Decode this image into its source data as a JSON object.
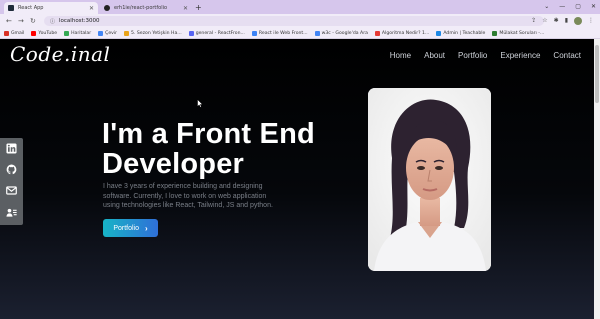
{
  "browser": {
    "tabs": [
      {
        "label": "React App",
        "active": true
      },
      {
        "label": "erh1ie/react-portfolio",
        "active": false
      }
    ],
    "new_tab": "+",
    "address": "localhost:3000",
    "bookmarks": [
      {
        "label": "Gmail",
        "color": "#d93025"
      },
      {
        "label": "YouTube",
        "color": "#ff0000"
      },
      {
        "label": "Haritalar",
        "color": "#34a853"
      },
      {
        "label": "Çevir",
        "color": "#4285f4"
      },
      {
        "label": "5. Sezon Yetişkin Ha...",
        "color": "#e9a31b"
      },
      {
        "label": "general - ReactFron...",
        "color": "#5865f2"
      },
      {
        "label": "React ile Web Front...",
        "color": "#3b82f6"
      },
      {
        "label": "w3c - Google'da Ara",
        "color": "#4285f4"
      },
      {
        "label": "Algoritma Nedir? 1...",
        "color": "#e53935"
      },
      {
        "label": "Admin | Teachable",
        "color": "#1e88e5"
      },
      {
        "label": "Mülakat Soruları -...",
        "color": "#2e7d32"
      }
    ]
  },
  "site": {
    "logo": "Code.inal",
    "nav": [
      "Home",
      "About",
      "Portfolio",
      "Experience",
      "Contact"
    ],
    "hero": {
      "title_line1": "I'm a Front End",
      "title_line2": "Developer",
      "bio": "I have 3 years of experience building and designing software. Currently, I love to work on web application using technologies like React, Tailwind, JS and python.",
      "cta_label": "Portfolio",
      "cta_icon": "chevron-right-icon"
    },
    "social": [
      "linkedin-icon",
      "github-icon",
      "mail-icon",
      "resume-icon"
    ]
  },
  "colors": {
    "accent_start": "#17b4c6",
    "accent_end": "#2f6fd8",
    "background": "#000000",
    "chrome": "#d6c6ec"
  }
}
